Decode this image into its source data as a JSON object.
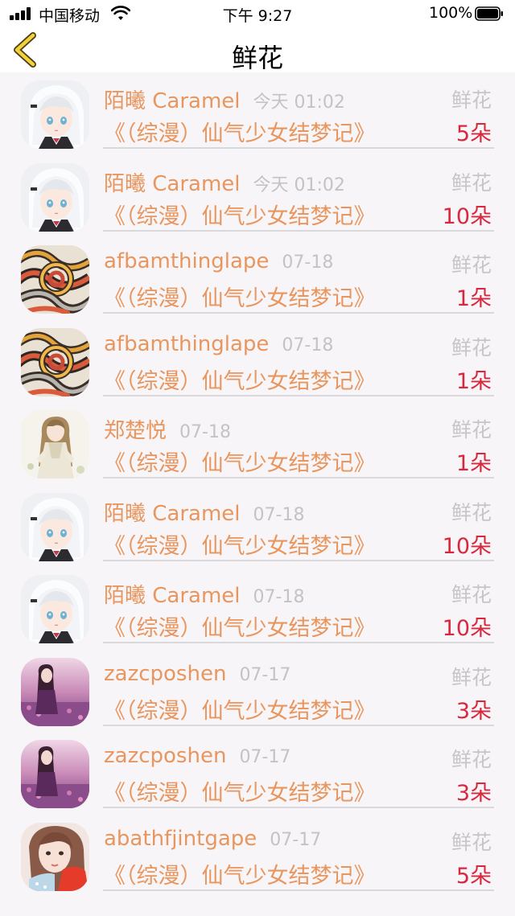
{
  "status_bar": {
    "carrier": "中国移动",
    "time": "下午 9:27",
    "battery": "100%"
  },
  "nav": {
    "title": "鲜花"
  },
  "colors": {
    "name": "#e9965e",
    "count": "#d8283e",
    "muted": "#c3c3c6"
  },
  "records": [
    {
      "name": "陌曦 Caramel",
      "time": "今天 01:02",
      "type": "鲜花",
      "book": "《（综漫）仙气少女结梦记》",
      "count": "5朵",
      "avatar_icon": "white-hair-anime-girl-avatar"
    },
    {
      "name": "陌曦 Caramel",
      "time": "今天 01:02",
      "type": "鲜花",
      "book": "《（综漫）仙气少女结梦记》",
      "count": "10朵",
      "avatar_icon": "white-hair-anime-girl-avatar"
    },
    {
      "name": "afbamthinglape",
      "time": "07-18",
      "type": "鲜花",
      "book": "《（综漫）仙气少女结梦记》",
      "count": "1朵",
      "avatar_icon": "abstract-swirl-art-avatar"
    },
    {
      "name": "afbamthinglape",
      "time": "07-18",
      "type": "鲜花",
      "book": "《（综漫）仙气少女结梦记》",
      "count": "1朵",
      "avatar_icon": "abstract-swirl-art-avatar"
    },
    {
      "name": "郑楚悦",
      "time": "07-18",
      "type": "鲜花",
      "book": "《（综漫）仙气少女结梦记》",
      "count": "1朵",
      "avatar_icon": "anime-girl-dress-avatar"
    },
    {
      "name": "陌曦 Caramel",
      "time": "07-18",
      "type": "鲜花",
      "book": "《（综漫）仙气少女结梦记》",
      "count": "10朵",
      "avatar_icon": "white-hair-anime-girl-avatar"
    },
    {
      "name": "陌曦 Caramel",
      "time": "07-18",
      "type": "鲜花",
      "book": "《（综漫）仙气少女结梦记》",
      "count": "10朵",
      "avatar_icon": "white-hair-anime-girl-avatar"
    },
    {
      "name": "zazcposhen",
      "time": "07-17",
      "type": "鲜花",
      "book": "《（综漫）仙气少女结梦记》",
      "count": "3朵",
      "avatar_icon": "girl-purple-field-avatar"
    },
    {
      "name": "zazcposhen",
      "time": "07-17",
      "type": "鲜花",
      "book": "《（综漫）仙气少女结梦记》",
      "count": "3朵",
      "avatar_icon": "girl-purple-field-avatar"
    },
    {
      "name": "abathfjintgape",
      "time": "07-17",
      "type": "鲜花",
      "book": "《（综漫）仙气少女结梦记》",
      "count": "5朵",
      "avatar_icon": "girl-photo-avatar"
    }
  ]
}
